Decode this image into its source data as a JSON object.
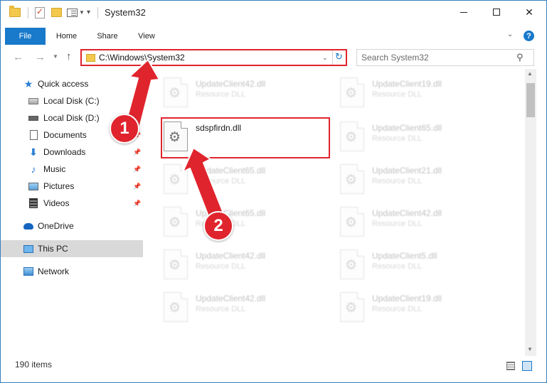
{
  "window": {
    "title": "System32",
    "controls": {
      "minimize": "—",
      "maximize": "",
      "close": "✕"
    }
  },
  "ribbon": {
    "tabs": [
      {
        "label": "File",
        "active": true
      },
      {
        "label": "Home"
      },
      {
        "label": "Share"
      },
      {
        "label": "View"
      }
    ],
    "help": "?"
  },
  "nav": {
    "address": "C:\\Windows\\System32",
    "search_placeholder": "Search System32"
  },
  "sidebar": {
    "quick_access": "Quick access",
    "items": [
      {
        "label": "Local Disk (C:)",
        "icon": "disk-icon",
        "pinned": false
      },
      {
        "label": "Local Disk (D:)",
        "icon": "disk-icon",
        "pinned": false
      },
      {
        "label": "Documents",
        "icon": "documents-icon",
        "pinned": true
      },
      {
        "label": "Downloads",
        "icon": "downloads-icon",
        "pinned": true
      },
      {
        "label": "Music",
        "icon": "music-icon",
        "pinned": true
      },
      {
        "label": "Pictures",
        "icon": "pictures-icon",
        "pinned": true
      },
      {
        "label": "Videos",
        "icon": "videos-icon",
        "pinned": true
      }
    ],
    "onedrive": "OneDrive",
    "this_pc": "This PC",
    "network": "Network"
  },
  "files": [
    {
      "name": "UpdateClient42.dll",
      "type": "Resource DLL",
      "faded": true
    },
    {
      "name": "UpdateClient19.dll",
      "type": "Resource DLL",
      "faded": true
    },
    {
      "name": "sdspfirdn.dll",
      "type": "",
      "faded": false,
      "highlighted": true
    },
    {
      "name": "UpdateClient65.dll",
      "type": "Resource DLL",
      "faded": true
    },
    {
      "name": "UpdateClient65.dll",
      "type": "Resource DLL",
      "faded": true
    },
    {
      "name": "UpdateClient21.dll",
      "type": "Resource DLL",
      "faded": true
    },
    {
      "name": "UpdateClient65.dll",
      "type": "Resource DLL",
      "faded": true
    },
    {
      "name": "UpdateClient42.dll",
      "type": "Resource DLL",
      "faded": true
    },
    {
      "name": "UpdateClient42.dll",
      "type": "Resource DLL",
      "faded": true
    },
    {
      "name": "UpdateClient5.dll",
      "type": "Resource DLL",
      "faded": true
    },
    {
      "name": "UpdateClient42.dll",
      "type": "Resource DLL",
      "faded": true
    },
    {
      "name": "UpdateClient19.dll",
      "type": "Resource DLL",
      "faded": true
    }
  ],
  "status": {
    "items_count": "190 items"
  },
  "annotations": {
    "step1": "1",
    "step2": "2",
    "color": "#e0242d"
  },
  "colors": {
    "accent": "#1979ca",
    "highlight": "#e0242d"
  }
}
